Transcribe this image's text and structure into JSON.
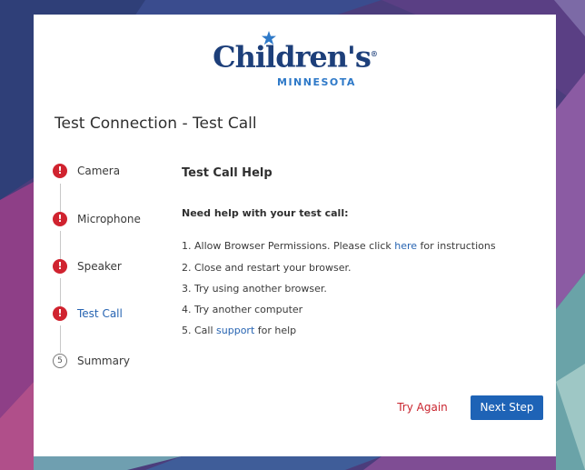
{
  "brand": {
    "name": "Children's",
    "registered": "®",
    "subtitle": "MINNESOTA"
  },
  "page": {
    "title": "Test Connection - Test Call"
  },
  "steps": [
    {
      "label": "Camera",
      "status": "error",
      "icon": "!"
    },
    {
      "label": "Microphone",
      "status": "error",
      "icon": "!"
    },
    {
      "label": "Speaker",
      "status": "error",
      "icon": "!"
    },
    {
      "label": "Test Call",
      "status": "error-active",
      "icon": "!"
    },
    {
      "label": "Summary",
      "status": "pending",
      "icon": "5"
    }
  ],
  "help": {
    "title": "Test Call Help",
    "question": "Need help with your test call:",
    "items": [
      {
        "before": "1. Allow Browser Permissions. Please click ",
        "link": "here",
        "after": " for instructions"
      },
      {
        "before": "2. Close and restart your browser.",
        "link": "",
        "after": ""
      },
      {
        "before": "3. Try using another browser.",
        "link": "",
        "after": ""
      },
      {
        "before": "4. Try another computer",
        "link": "",
        "after": ""
      },
      {
        "before": "5. Call ",
        "link": "support",
        "after": " for help"
      }
    ]
  },
  "actions": {
    "try_again": "Try Again",
    "next_step": "Next Step"
  },
  "colors": {
    "error": "#d0232f",
    "link": "#2764b2",
    "primary_button": "#1e63b6",
    "brand_navy": "#1d3f7a",
    "brand_blue": "#2e79c8"
  }
}
